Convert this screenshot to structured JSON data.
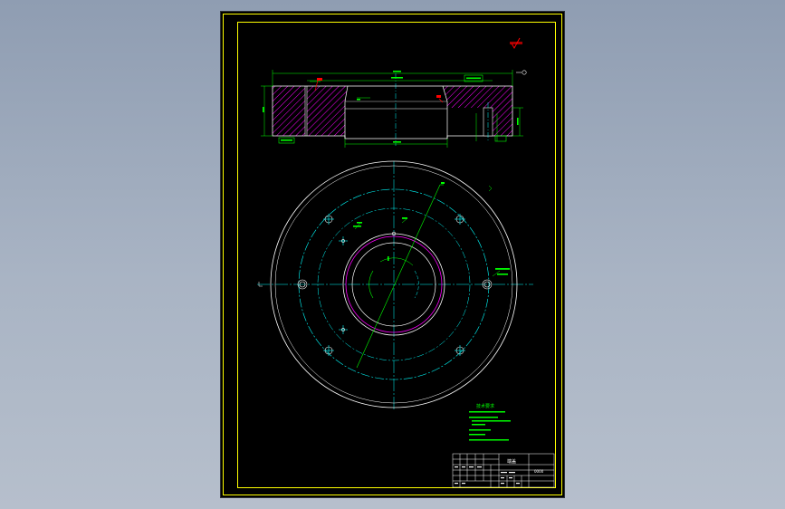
{
  "viewer": {
    "background_top": "#8f9db2",
    "background_bottom": "#b6bfcc"
  },
  "drawing": {
    "paper_color": "#000000",
    "colors": {
      "border": "#ffff00",
      "outline": "#ffffff",
      "centerline": "#00ffff",
      "hatch": "#ff00ff",
      "dimension": "#00ff00",
      "rough_mark": "#ff0000",
      "text": "#00ff00"
    },
    "title_block": {
      "part_name": "端盖",
      "drawing_no": "0000"
    },
    "notes": {
      "heading": "技术要求"
    }
  }
}
